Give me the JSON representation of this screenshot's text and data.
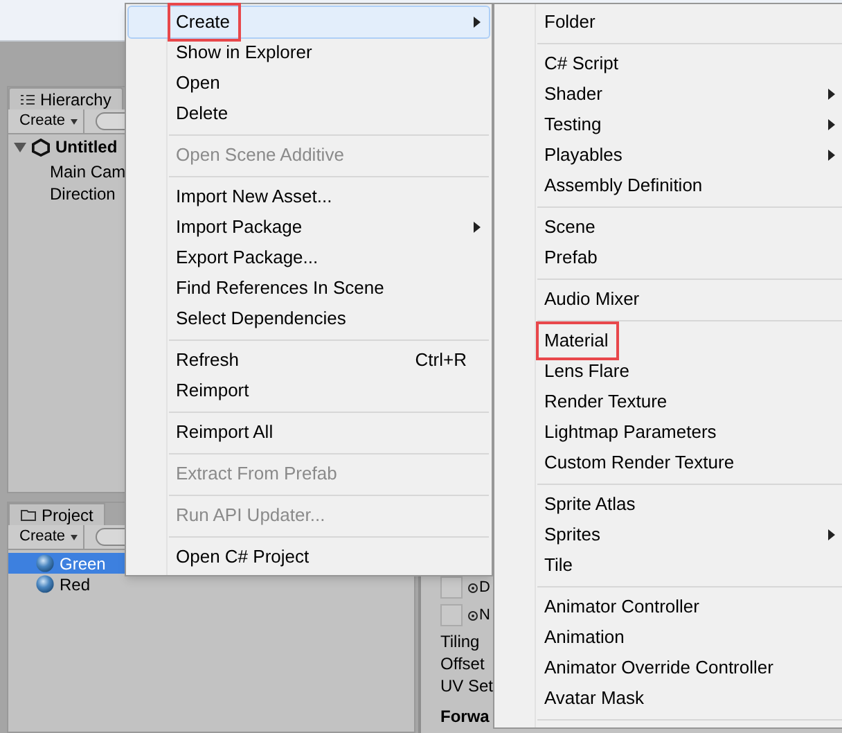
{
  "hierarchy": {
    "tab": "Hierarchy",
    "create_button": "Create",
    "scene": "Untitled",
    "items": [
      "Main Cam",
      "Direction"
    ]
  },
  "project": {
    "tab": "Project",
    "create_button": "Create",
    "items": [
      {
        "label": "Green",
        "selected": true
      },
      {
        "label": "Red",
        "selected": false
      }
    ]
  },
  "inspector": {
    "slots": [
      "D",
      "N"
    ],
    "labels": [
      "Tiling",
      "Offset",
      "UV Set"
    ],
    "section": "Forwa"
  },
  "context_menu": {
    "items": [
      {
        "kind": "item",
        "label": "Create",
        "submenu": true,
        "selected": true,
        "annotated": true,
        "disabled": false
      },
      {
        "kind": "item",
        "label": "Show in Explorer",
        "submenu": false,
        "selected": false,
        "annotated": false,
        "disabled": false
      },
      {
        "kind": "item",
        "label": "Open",
        "submenu": false,
        "selected": false,
        "annotated": false,
        "disabled": false
      },
      {
        "kind": "item",
        "label": "Delete",
        "submenu": false,
        "selected": false,
        "annotated": false,
        "disabled": false
      },
      {
        "kind": "separator"
      },
      {
        "kind": "item",
        "label": "Open Scene Additive",
        "submenu": false,
        "selected": false,
        "annotated": false,
        "disabled": true
      },
      {
        "kind": "separator"
      },
      {
        "kind": "item",
        "label": "Import New Asset...",
        "submenu": false,
        "selected": false,
        "annotated": false,
        "disabled": false
      },
      {
        "kind": "item",
        "label": "Import Package",
        "submenu": true,
        "selected": false,
        "annotated": false,
        "disabled": false
      },
      {
        "kind": "item",
        "label": "Export Package...",
        "submenu": false,
        "selected": false,
        "annotated": false,
        "disabled": false
      },
      {
        "kind": "item",
        "label": "Find References In Scene",
        "submenu": false,
        "selected": false,
        "annotated": false,
        "disabled": false
      },
      {
        "kind": "item",
        "label": "Select Dependencies",
        "submenu": false,
        "selected": false,
        "annotated": false,
        "disabled": false
      },
      {
        "kind": "separator"
      },
      {
        "kind": "item",
        "label": "Refresh",
        "shortcut": "Ctrl+R",
        "submenu": false,
        "selected": false,
        "annotated": false,
        "disabled": false
      },
      {
        "kind": "item",
        "label": "Reimport",
        "submenu": false,
        "selected": false,
        "annotated": false,
        "disabled": false
      },
      {
        "kind": "separator"
      },
      {
        "kind": "item",
        "label": "Reimport All",
        "submenu": false,
        "selected": false,
        "annotated": false,
        "disabled": false
      },
      {
        "kind": "separator"
      },
      {
        "kind": "item",
        "label": "Extract From Prefab",
        "submenu": false,
        "selected": false,
        "annotated": false,
        "disabled": true
      },
      {
        "kind": "separator"
      },
      {
        "kind": "item",
        "label": "Run API Updater...",
        "submenu": false,
        "selected": false,
        "annotated": false,
        "disabled": true
      },
      {
        "kind": "separator"
      },
      {
        "kind": "item",
        "label": "Open C# Project",
        "submenu": false,
        "selected": false,
        "annotated": false,
        "disabled": false
      }
    ]
  },
  "submenu": {
    "items": [
      {
        "kind": "item",
        "label": "Folder",
        "submenu": false,
        "selected": false,
        "annotated": false,
        "disabled": false
      },
      {
        "kind": "separator"
      },
      {
        "kind": "item",
        "label": "C# Script",
        "submenu": false,
        "selected": false,
        "annotated": false,
        "disabled": false
      },
      {
        "kind": "item",
        "label": "Shader",
        "submenu": true,
        "selected": false,
        "annotated": false,
        "disabled": false
      },
      {
        "kind": "item",
        "label": "Testing",
        "submenu": true,
        "selected": false,
        "annotated": false,
        "disabled": false
      },
      {
        "kind": "item",
        "label": "Playables",
        "submenu": true,
        "selected": false,
        "annotated": false,
        "disabled": false
      },
      {
        "kind": "item",
        "label": "Assembly Definition",
        "submenu": false,
        "selected": false,
        "annotated": false,
        "disabled": false
      },
      {
        "kind": "separator"
      },
      {
        "kind": "item",
        "label": "Scene",
        "submenu": false,
        "selected": false,
        "annotated": false,
        "disabled": false
      },
      {
        "kind": "item",
        "label": "Prefab",
        "submenu": false,
        "selected": false,
        "annotated": false,
        "disabled": false
      },
      {
        "kind": "separator"
      },
      {
        "kind": "item",
        "label": "Audio Mixer",
        "submenu": false,
        "selected": false,
        "annotated": false,
        "disabled": false
      },
      {
        "kind": "separator"
      },
      {
        "kind": "item",
        "label": "Material",
        "submenu": false,
        "selected": false,
        "annotated": true,
        "disabled": false
      },
      {
        "kind": "item",
        "label": "Lens Flare",
        "submenu": false,
        "selected": false,
        "annotated": false,
        "disabled": false
      },
      {
        "kind": "item",
        "label": "Render Texture",
        "submenu": false,
        "selected": false,
        "annotated": false,
        "disabled": false
      },
      {
        "kind": "item",
        "label": "Lightmap Parameters",
        "submenu": false,
        "selected": false,
        "annotated": false,
        "disabled": false
      },
      {
        "kind": "item",
        "label": "Custom Render Texture",
        "submenu": false,
        "selected": false,
        "annotated": false,
        "disabled": false
      },
      {
        "kind": "separator"
      },
      {
        "kind": "item",
        "label": "Sprite Atlas",
        "submenu": false,
        "selected": false,
        "annotated": false,
        "disabled": false
      },
      {
        "kind": "item",
        "label": "Sprites",
        "submenu": true,
        "selected": false,
        "annotated": false,
        "disabled": false
      },
      {
        "kind": "item",
        "label": "Tile",
        "submenu": false,
        "selected": false,
        "annotated": false,
        "disabled": false
      },
      {
        "kind": "separator"
      },
      {
        "kind": "item",
        "label": "Animator Controller",
        "submenu": false,
        "selected": false,
        "annotated": false,
        "disabled": false
      },
      {
        "kind": "item",
        "label": "Animation",
        "submenu": false,
        "selected": false,
        "annotated": false,
        "disabled": false
      },
      {
        "kind": "item",
        "label": "Animator Override Controller",
        "submenu": false,
        "selected": false,
        "annotated": false,
        "disabled": false
      },
      {
        "kind": "item",
        "label": "Avatar Mask",
        "submenu": false,
        "selected": false,
        "annotated": false,
        "disabled": false
      },
      {
        "kind": "separator"
      }
    ]
  }
}
